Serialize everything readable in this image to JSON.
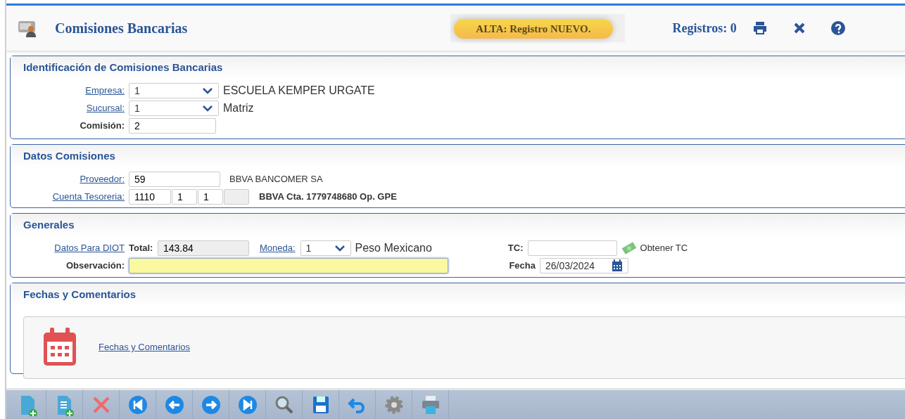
{
  "header": {
    "title": "Comisiones Bancarias",
    "status_badge": "ALTA: Registro NUEVO.",
    "records": "Registros: 0",
    "actions": [
      {
        "kind": "print"
      },
      {
        "kind": "close"
      },
      {
        "kind": "help"
      }
    ]
  },
  "identificacion": {
    "title": "Identificación de Comisiones Bancarias",
    "fields": [
      {
        "label": "Empresa:",
        "label_link": true,
        "kind": "select",
        "value": "1",
        "description": "ESCUELA KEMPER URGATE"
      },
      {
        "label": "Sucursal:",
        "label_link": true,
        "kind": "select",
        "value": "1",
        "description": "Matriz"
      },
      {
        "label": "Comisión:",
        "label_link": false,
        "kind": "input",
        "value": "2"
      }
    ]
  },
  "datos": {
    "title": "Datos Comisiones",
    "proveedor": {
      "label": "Proveedor:",
      "value": "59",
      "description": "BBVA BANCOMER SA"
    },
    "cuenta": {
      "label": "Cuenta Tesoreria:",
      "segments": [
        {
          "value": "1110",
          "disabled": false
        },
        {
          "value": "1",
          "disabled": false
        },
        {
          "value": "1",
          "disabled": false
        },
        {
          "disabled": true
        }
      ],
      "description": "BBVA Cta. 1779748680 Op. GPE"
    }
  },
  "generales": {
    "title": "Generales",
    "diot_link": "Datos Para DIOT",
    "total": {
      "label": "Total:",
      "value": "143.84"
    },
    "moneda": {
      "label": "Moneda:",
      "value": "1",
      "description": "Peso Mexicano"
    },
    "tc": {
      "label": "TC:",
      "action": "Obtener TC"
    },
    "observacion": {
      "label": "Observación:",
      "focused": true
    },
    "fecha": {
      "label": "Fecha",
      "value": "26/03/2024"
    }
  },
  "fechas": {
    "title": "Fechas y Comentarios",
    "link": "Fechas y Comentarios"
  },
  "toolbar": [
    {
      "kind": "new"
    },
    {
      "kind": "new-list"
    },
    {
      "kind": "delete"
    },
    {
      "kind": "first"
    },
    {
      "kind": "prev"
    },
    {
      "kind": "next"
    },
    {
      "kind": "last"
    },
    {
      "kind": "search"
    },
    {
      "kind": "save"
    },
    {
      "kind": "undo"
    },
    {
      "kind": "settings"
    },
    {
      "kind": "print"
    }
  ]
}
